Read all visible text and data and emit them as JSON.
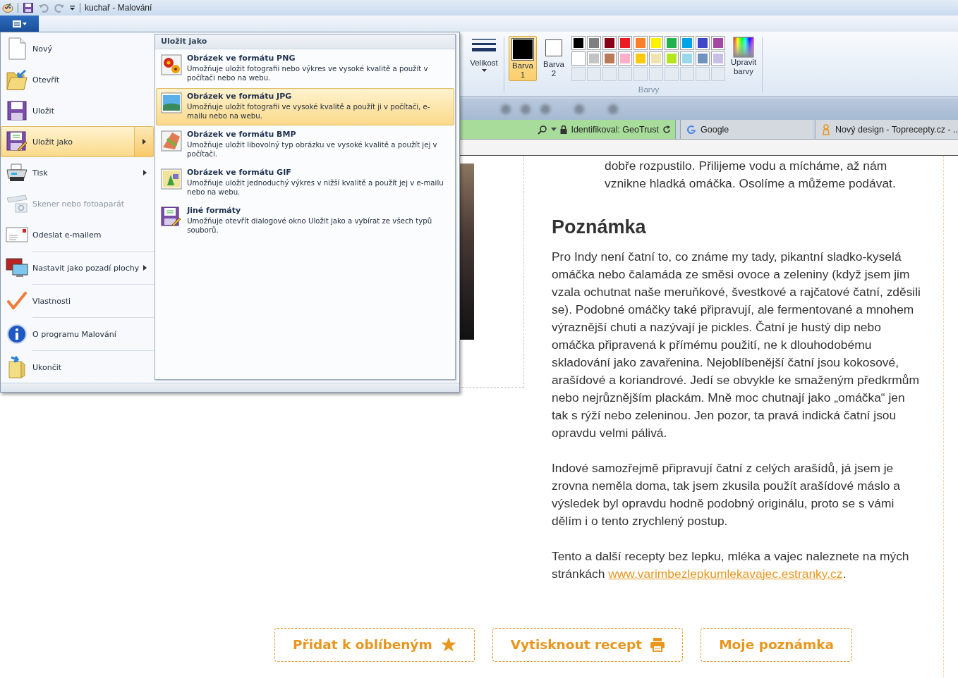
{
  "window": {
    "title": "kuchař - Malování"
  },
  "quick_access": [
    {
      "disabled": false
    },
    {
      "disabled": true
    },
    {
      "disabled": true
    }
  ],
  "ribbon": {
    "size_button": {
      "label": "Velikost"
    },
    "color_buttons": [
      {
        "label": "Barva 1",
        "color": "#000000",
        "selected": true
      },
      {
        "label": "Barva 2",
        "color": "#ffffff",
        "selected": false
      }
    ],
    "palette": [
      {
        "color": "#000000"
      },
      {
        "color": "#7f7f7f"
      },
      {
        "color": "#880015"
      },
      {
        "color": "#ed1c24"
      },
      {
        "color": "#ff7f27"
      },
      {
        "color": "#fff200"
      },
      {
        "color": "#22b14c"
      },
      {
        "color": "#00a2e8"
      },
      {
        "color": "#3f48cc"
      },
      {
        "color": "#a349a4"
      },
      {
        "color": "#ffffff"
      },
      {
        "color": "#c3c3c3"
      },
      {
        "color": "#b97a57"
      },
      {
        "color": "#ffaec9"
      },
      {
        "color": "#ffc90e"
      },
      {
        "color": "#efe4b0"
      },
      {
        "color": "#b5e61d"
      },
      {
        "color": "#99d9ea"
      },
      {
        "color": "#7092be"
      },
      {
        "color": "#c8bfe7"
      },
      {
        "kind": "empty"
      },
      {
        "kind": "empty"
      },
      {
        "kind": "empty"
      },
      {
        "kind": "empty"
      },
      {
        "kind": "empty"
      },
      {
        "kind": "empty"
      },
      {
        "kind": "empty"
      },
      {
        "kind": "empty"
      },
      {
        "kind": "empty"
      },
      {
        "kind": "empty"
      }
    ],
    "edit_colors": {
      "label": "Upravit barvy"
    },
    "group_label": "Barvy"
  },
  "app_menu": {
    "items": [
      {
        "label": "Nový",
        "selected": false,
        "disabled": false,
        "submenu": false,
        "divider": false
      },
      {
        "label": "Otevřít",
        "selected": false,
        "disabled": false,
        "submenu": false,
        "divider": false
      },
      {
        "label": "Uložit",
        "selected": false,
        "disabled": false,
        "submenu": false,
        "divider": false
      },
      {
        "label": "Uložit jako",
        "selected": true,
        "disabled": false,
        "submenu": true,
        "divider": false
      },
      {
        "label": "Tisk",
        "selected": false,
        "disabled": false,
        "submenu": true,
        "divider": false
      },
      {
        "label": "Skener nebo fotoaparát",
        "selected": false,
        "disabled": true,
        "submenu": false,
        "divider": false
      },
      {
        "label": "Odeslat e-mailem",
        "selected": false,
        "disabled": false,
        "submenu": false,
        "divider": false
      },
      {
        "label": "Nastavit jako pozadí plochy",
        "selected": false,
        "disabled": false,
        "submenu": true,
        "divider": true
      },
      {
        "label": "Vlastnosti",
        "selected": false,
        "disabled": false,
        "submenu": false,
        "divider": true
      },
      {
        "label": "O programu Malování",
        "selected": false,
        "disabled": false,
        "submenu": false,
        "divider": true
      },
      {
        "label": "Ukončit",
        "selected": false,
        "disabled": false,
        "submenu": false,
        "divider": true
      }
    ],
    "submenu": {
      "title": "Uložit jako",
      "items": [
        {
          "title": "Obrázek ve formátu PNG",
          "description": "Umožňuje uložit fotografii nebo výkres ve vysoké kvalitě a použít v počítači nebo na webu.",
          "selected": false
        },
        {
          "title": "Obrázek ve formátu JPG",
          "description": "Umožňuje uložit fotografii ve vysoké kvalitě a použít ji v počítači, e-mailu nebo na webu.",
          "selected": true
        },
        {
          "title": "Obrázek ve formátu BMP",
          "description": "Umožňuje uložit libovolný typ obrázku ve vysoké kvalitě a použít jej v počítači.",
          "selected": false
        },
        {
          "title": "Obrázek ve formátu GIF",
          "description": "Umožňuje uložit jednoduchý výkres v nižší kvalitě a použít jej v e-mailu nebo na webu.",
          "selected": false
        },
        {
          "title": "Jiné formáty",
          "description": "Umožňuje otevřít dialogové okno Uložit jako a vybírat ze všech typů souborů.",
          "selected": false
        }
      ]
    }
  },
  "browser": {
    "security": "Identifikoval: GeoTrust",
    "tabs": [
      {
        "label": "Google"
      },
      {
        "label": "Nový design - Toprecepty.cz - .."
      }
    ]
  },
  "article": {
    "step_text": "dobře rozpustilo. Přilijeme vodu a mícháme, až nám vznikne hladká omáčka. Osolíme a můžeme podávat.",
    "heading": "Poznámka",
    "paragraphs": [
      {
        "text": "Pro Indy není čatní to, co známe my tady, pikantní sladko-kyselá omáčka nebo čalamáda ze směsi ovoce a zeleniny (když jsem jim vzala ochutnat naše meruňkové, švestkové a rajčatové čatní, zděsili se). Podobné omáčky také připravují, ale fermentované a mnohem výraznější chuti a nazývají je pickles. Čatní je hustý dip nebo omáčka připravená k přímému použití, ne k dlouhodobému skladování jako zavařenina. Nejoblíbenější čatní jsou kokosové, arašídové a koriandrové. Jedí se obvykle ke smaženým předkrmům nebo nejrůznějším plackám. Mně moc chutnají jako „omáčka“ jen tak s rýží nebo zeleninou. Jen pozor, ta pravá indická čatní jsou opravdu velmi pálivá."
      },
      {
        "text": "Indové samozřejmě připravují čatní z celých arašídů, já jsem je zrovna neměla doma, tak jsem zkusila použít arašídové máslo a výsledek byl opravdu hodně podobný originálu, proto se s vámi dělím i o tento zrychlený postup."
      },
      {
        "text": "Tento a další recepty bez lepku, mléka a vajec naleznete na mých stránkách ",
        "link": "www.varimbezlepkumlekavajec.estranky.cz",
        "after": "."
      }
    ]
  },
  "actions": [
    {
      "label": "Přidat k oblíbeným"
    },
    {
      "label": "Vytisknout recept"
    },
    {
      "label": "Moje poznámka"
    }
  ]
}
